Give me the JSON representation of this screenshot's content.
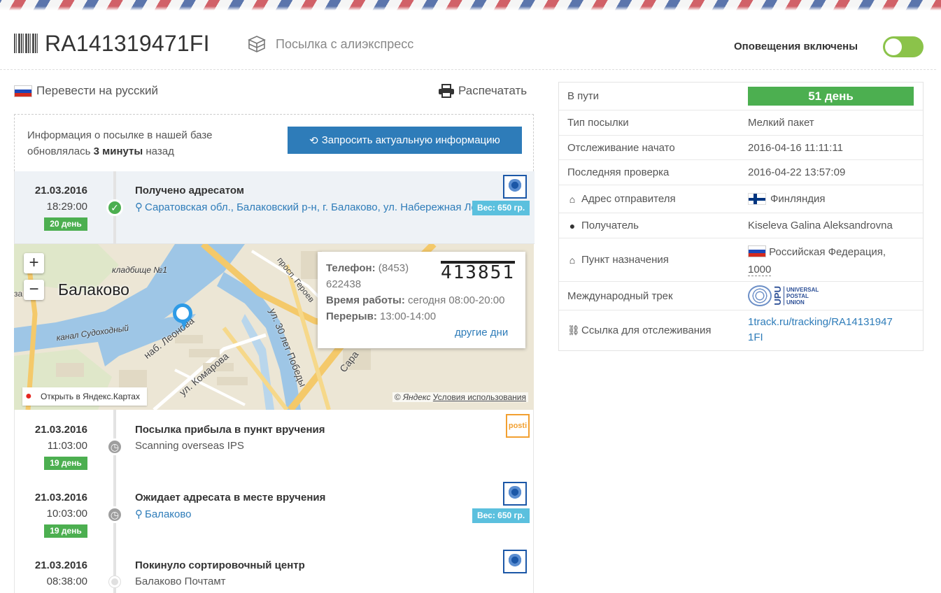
{
  "header": {
    "tracking_number": "RA141319471FI",
    "parcel_name": "Посылка с алиэкспресс",
    "notifications_label": "Оповещения включены",
    "notifications_on": true
  },
  "actions": {
    "translate_label": "Перевести на русский",
    "print_label": "Распечатать"
  },
  "info_box": {
    "line1": "Информация о посылке в нашей базе",
    "line2_prefix": "обновлялась ",
    "line2_bold": "3 минуты",
    "line2_suffix": " назад",
    "refresh_button": "Запросить актуальную информацию"
  },
  "events": [
    {
      "date": "21.03.2016",
      "time": "18:29:00",
      "days": "20 день",
      "title": "Получено адресатом",
      "location": "Саратовская обл., Балаковский р-н, г. Балаково, ул. Набережная Леонова",
      "weight": "Вес: 650 гр.",
      "carrier": "russian-post"
    },
    {
      "date": "21.03.2016",
      "time": "11:03:00",
      "days": "19 день",
      "title": "Посылка прибыла в пункт вручения",
      "subtitle": "Scanning overseas IPS",
      "carrier": "posti",
      "carrier_text": "posti"
    },
    {
      "date": "21.03.2016",
      "time": "10:03:00",
      "days": "19 день",
      "title": "Ожидает адресата в месте вручения",
      "location": "Балаково",
      "weight": "Вес: 650 гр.",
      "carrier": "russian-post"
    },
    {
      "date": "21.03.2016",
      "time": "08:38:00",
      "title": "Покинуло сортировочный центр",
      "subtitle": "Балаково Почтамт",
      "carrier": "russian-post"
    }
  ],
  "map": {
    "city": "Балаково",
    "labels": {
      "cemetery": "кладбище №1",
      "canal": "канал Судоходный",
      "embankment": "наб. Леонова",
      "street_komarova": "ул. Комарова",
      "street_30_let": "ул. 30 лет Победы",
      "prosp_geroev": "просп. Героев",
      "sar": "Сара",
      "sa": "за"
    },
    "popup": {
      "phone_label": "Телефон:",
      "phone_code": "(8453)",
      "phone_number": "622438",
      "hours_label": "Время работы:",
      "hours_value": "сегодня 08:00-20:00",
      "break_label": "Перерыв:",
      "break_value": "13:00-14:00",
      "other_days": "другие дни",
      "postcode": "413851"
    },
    "open_in_yandex": "Открыть в Яндекс.Картах",
    "copyright": "© Яндекс",
    "terms": "Условия использования",
    "zoom_in": "+",
    "zoom_out": "−"
  },
  "details": {
    "in_transit_label": "В пути",
    "in_transit_value": "51 день",
    "type_label": "Тип посылки",
    "type_value": "Мелкий пакет",
    "tracking_started_label": "Отслеживание начато",
    "tracking_started_value": "2016-04-16 11:11:11",
    "last_check_label": "Последняя проверка",
    "last_check_value": "2016-04-22 13:57:09",
    "sender_label": "Адрес отправителя",
    "sender_value": "Финляндия",
    "recipient_label": "Получатель",
    "recipient_value": "Kiseleva Galina Aleksandrovna",
    "destination_label": "Пункт назначения",
    "destination_value": "Российская Федерация,",
    "destination_zip": "1000",
    "intl_track_label": "Международный трек",
    "upu_word": "UPU",
    "upu_text1": "UNIVERSAL",
    "upu_text2": "POSTAL",
    "upu_text3": "UNION",
    "link_label": "Ссылка для отслеживания",
    "link_line1": "1track.ru/tracking/RA14131947",
    "link_line2": "1FI"
  },
  "colors": {
    "accent_blue": "#2e7cb9",
    "success_green": "#4caf50",
    "weight_badge": "#5bc0de",
    "toggle_on": "#8bc34a"
  }
}
